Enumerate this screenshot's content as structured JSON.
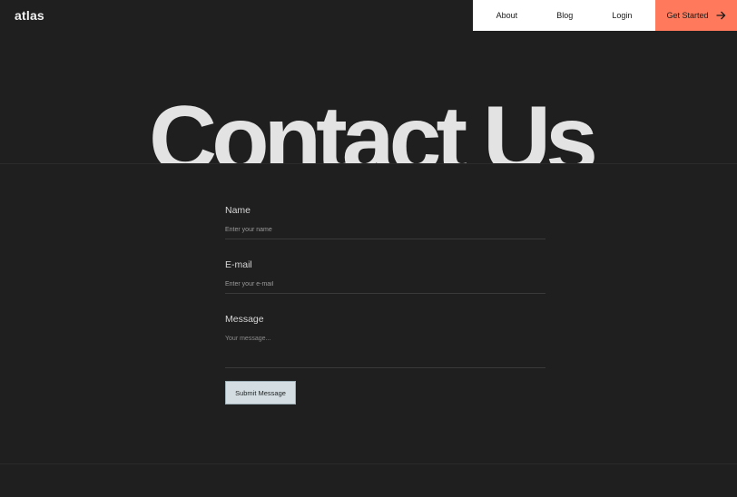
{
  "brand": {
    "logo": "atlas"
  },
  "nav": {
    "links": [
      "About",
      "Blog",
      "Login"
    ],
    "cta_label": "Get Started",
    "cta_color": "#ff7a5c",
    "cta_icon": "arrow-right-icon"
  },
  "hero": {
    "title": "Contact Us"
  },
  "form": {
    "name_label": "Name",
    "name_placeholder": "Enter your name",
    "email_label": "E-mail",
    "email_placeholder": "Enter your e-mail",
    "message_label": "Message",
    "message_placeholder": "Your message...",
    "submit_label": "Submit Message"
  },
  "colors": {
    "background": "#1f1f1f",
    "nav_background": "#ffffff",
    "submit_background": "#d4dee2"
  }
}
